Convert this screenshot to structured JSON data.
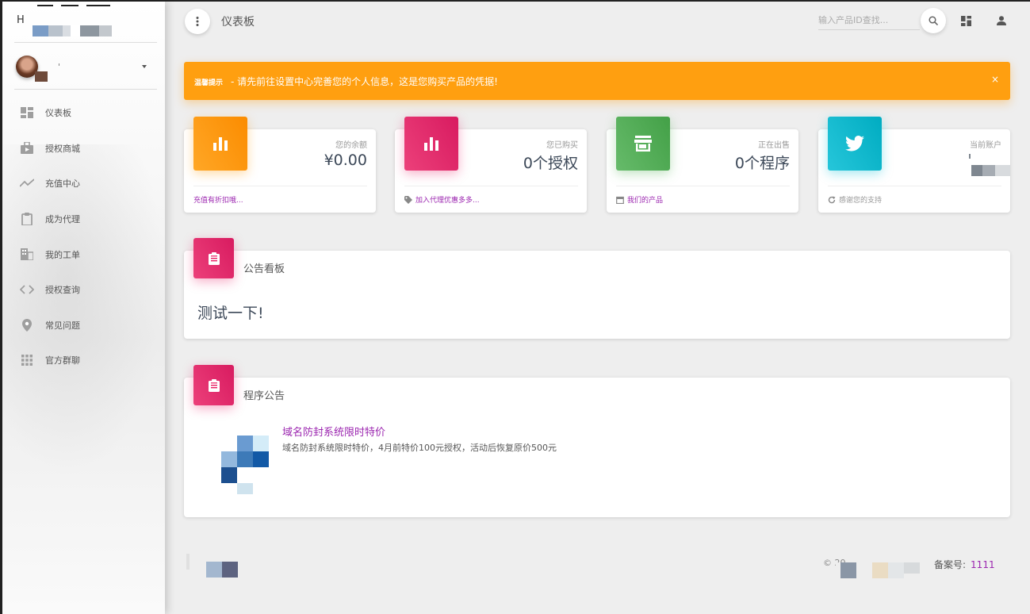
{
  "sidebar": {
    "brand_letter": "H",
    "user_name": "'",
    "items": [
      {
        "label": "仪表板",
        "icon": "dashboard-icon"
      },
      {
        "label": "授权商城",
        "icon": "shop-bag-icon"
      },
      {
        "label": "充值中心",
        "icon": "trending-icon"
      },
      {
        "label": "成为代理",
        "icon": "clipboard-icon"
      },
      {
        "label": "我的工单",
        "icon": "building-icon"
      },
      {
        "label": "授权查询",
        "icon": "code-icon"
      },
      {
        "label": "常见问题",
        "icon": "location-pin-icon"
      },
      {
        "label": "官方群聊",
        "icon": "apps-grid-icon"
      }
    ]
  },
  "header": {
    "title": "仪表板",
    "search_placeholder": "输入产品ID查找..."
  },
  "alert": {
    "strong": "温馨提示",
    "text": "- 请先前往设置中心完善您的个人信息，这是您购买产品的凭据!",
    "close": "×"
  },
  "stats": [
    {
      "label": "您的余额",
      "value": "¥0.00",
      "footer": "充值有折扣哦...",
      "icon": "bar-chart-icon",
      "color": "#ff9800"
    },
    {
      "label": "您已购买",
      "value": "0个授权",
      "footer": "加入代理优惠多多...",
      "icon": "bar-chart-icon",
      "color": "#e91e63"
    },
    {
      "label": "正在出售",
      "value": "0个程序",
      "footer": "我们的产品",
      "icon": "store-icon",
      "color": "#4caf50"
    },
    {
      "label": "当前账户",
      "value": "",
      "footer": "感谢您的支持",
      "icon": "twitter-icon",
      "color": "#00bcd4"
    }
  ],
  "notice_board": {
    "title": "公告看板",
    "content": "测试一下!"
  },
  "program_notice": {
    "title": "程序公告",
    "item_title": "域名防封系统限时特价",
    "item_desc": "域名防封系统限时特价，4月前特价100元授权，活动后恢复原价500元"
  },
  "footer": {
    "copyright": "© 20",
    "record_label": "备案号:",
    "record_number": "1111"
  }
}
